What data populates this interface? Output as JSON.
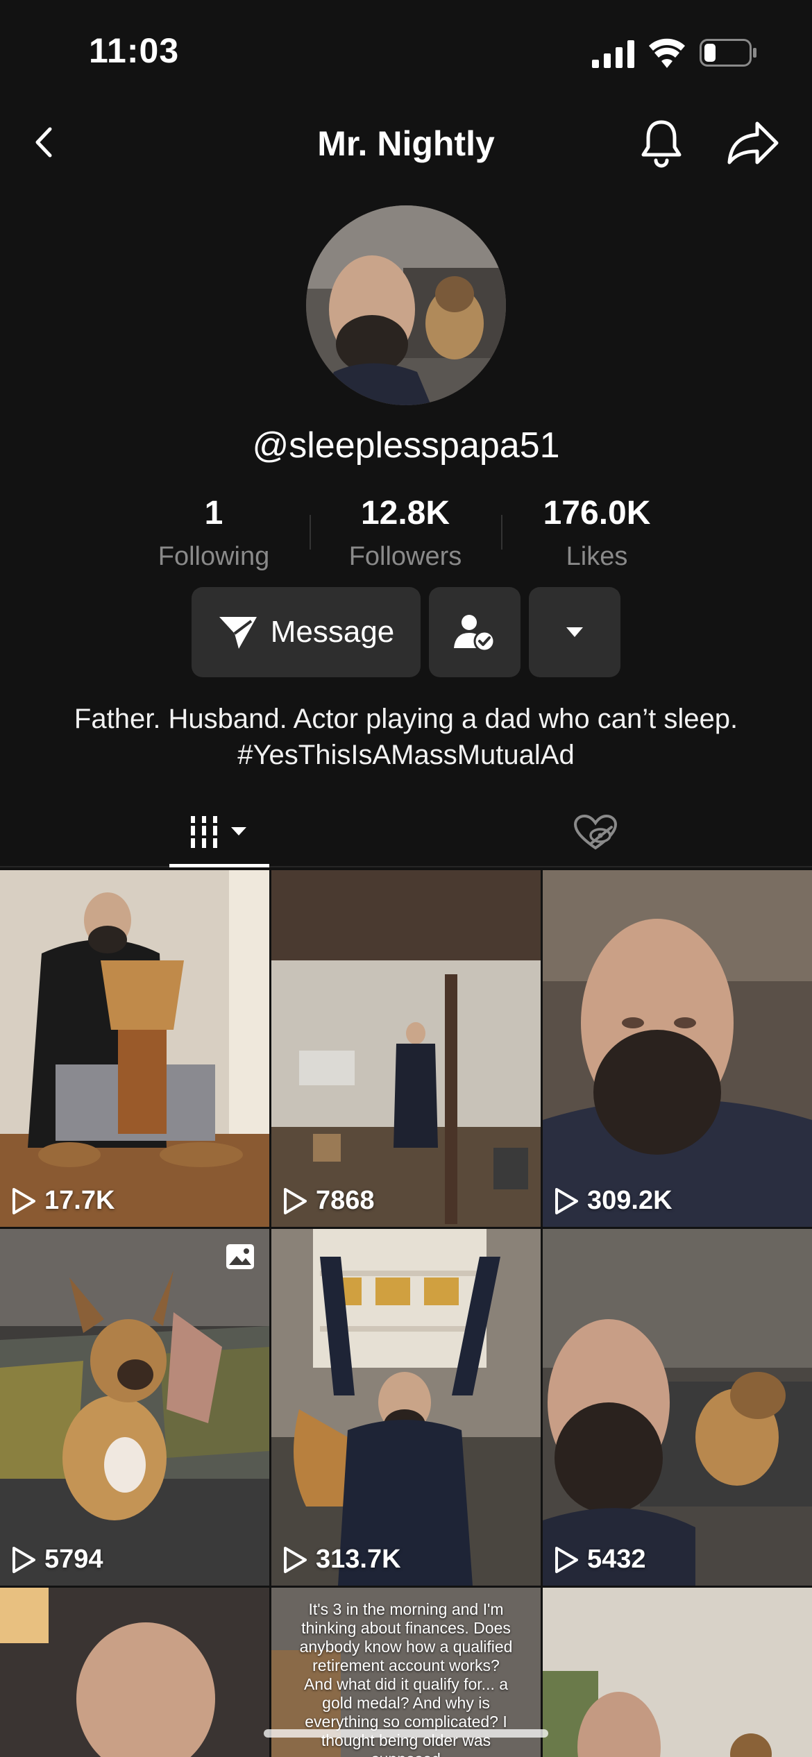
{
  "status_bar": {
    "time": "11:03"
  },
  "nav": {
    "title": "Mr. Nightly"
  },
  "profile": {
    "username": "@sleeplesspapa51",
    "bio": "Father. Husband. Actor playing a dad who can’t sleep. #YesThisIsAMassMutualAd"
  },
  "stats": [
    {
      "value": "1",
      "label": "Following"
    },
    {
      "value": "12.8K",
      "label": "Followers"
    },
    {
      "value": "176.0K",
      "label": "Likes"
    }
  ],
  "actions": {
    "message_label": "Message"
  },
  "videos": [
    {
      "views": "17.7K"
    },
    {
      "views": "7868"
    },
    {
      "views": "309.2K"
    },
    {
      "views": "5794"
    },
    {
      "views": "313.7K"
    },
    {
      "views": "5432"
    }
  ],
  "caption_tile": {
    "text": "It's 3 in the morning and I'm thinking about finances. Does anybody know how a qualified retirement account works? And what did it qualify for... a gold medal? And why is everything so complicated? I thought being older was supposed"
  },
  "colors": {
    "background": "#121212",
    "button": "#2e2e2e",
    "secondary_text": "#8a8a8a"
  }
}
